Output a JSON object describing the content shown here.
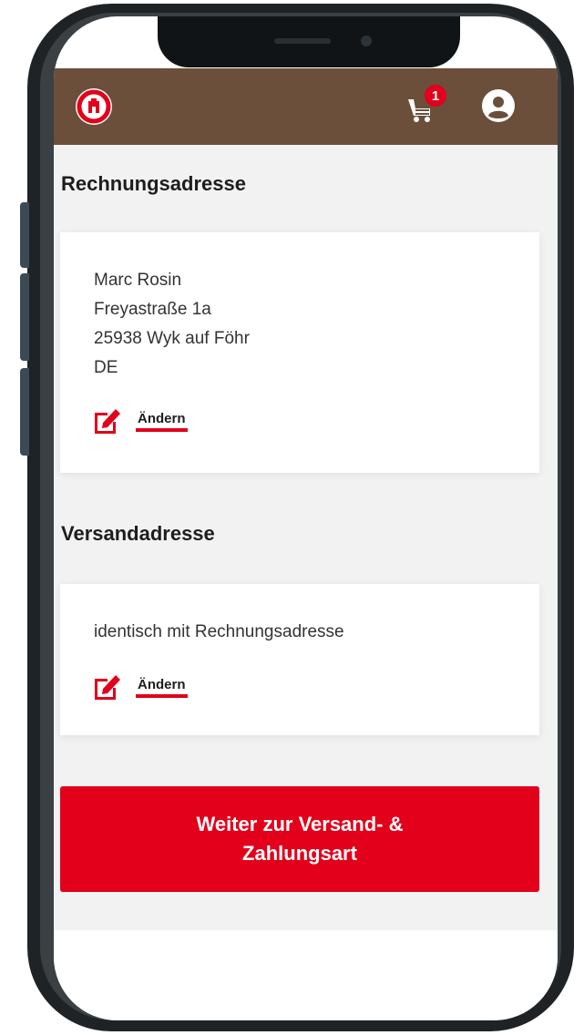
{
  "header": {
    "logo_icon": "fc-st-pauli-logo",
    "cart_badge": "1",
    "cart_icon": "cart-icon",
    "account_icon": "account-icon",
    "brand_color": "#6b4f3a",
    "accent_color": "#e2001a"
  },
  "billing": {
    "title": "Rechnungsadresse",
    "name": "Marc Rosin",
    "street": "Freyastraße 1a",
    "city": "25938 Wyk auf Föhr",
    "country": "DE",
    "edit_label": "Ändern"
  },
  "shipping": {
    "title": "Versandadresse",
    "text": "identisch mit Rechnungsadresse",
    "edit_label": "Ändern"
  },
  "cta": {
    "label": "Weiter zur Versand- & Zahlungsart"
  }
}
